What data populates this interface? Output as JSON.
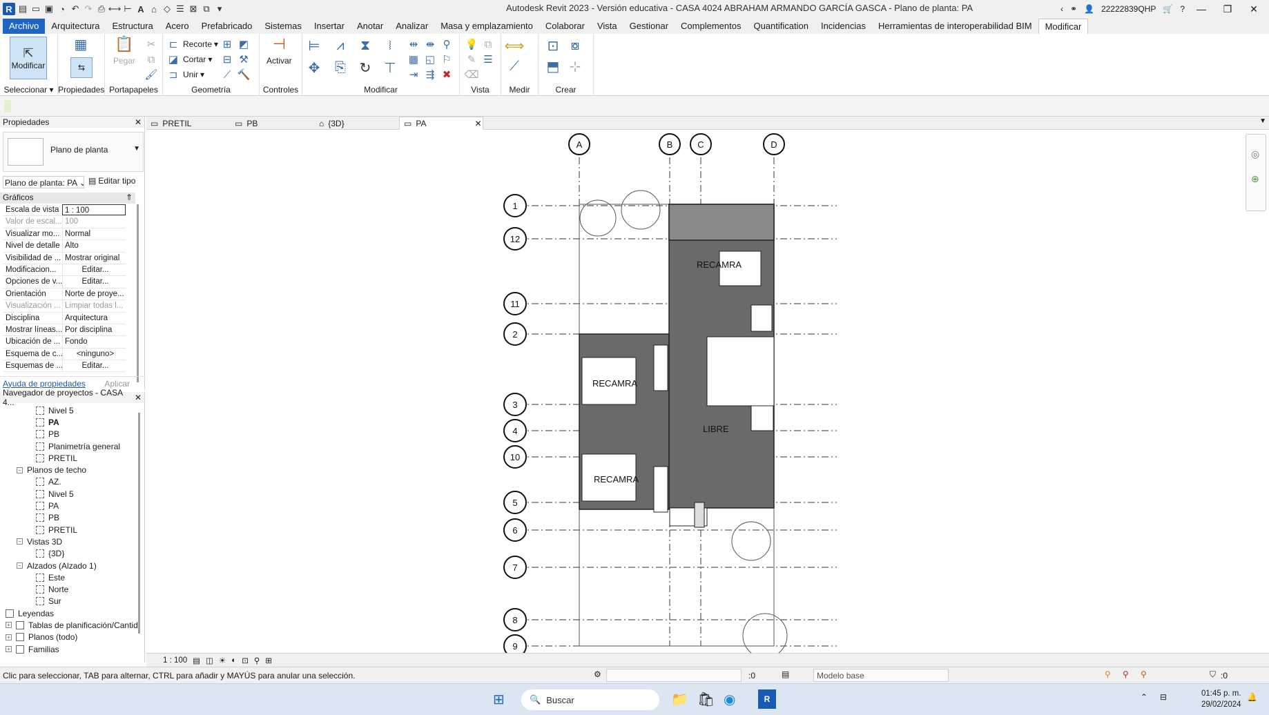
{
  "titlebar": {
    "title": "Autodesk Revit 2023 - Versión educativa - CASA 4024 ABRAHAM ARMANDO GARCÍA GASCA - Plano de planta: PA",
    "user": "22222839QHP"
  },
  "menu": {
    "items": [
      "Archivo",
      "Arquitectura",
      "Estructura",
      "Acero",
      "Prefabricado",
      "Sistemas",
      "Insertar",
      "Anotar",
      "Analizar",
      "Masa y emplazamiento",
      "Colaborar",
      "Vista",
      "Gestionar",
      "Complementos",
      "Quantification",
      "Incidencias",
      "Herramientas de interoperabilidad BIM",
      "Modificar"
    ]
  },
  "ribbon": {
    "modificar": "Modificar",
    "seleccionar": "Seleccionar ▾",
    "propiedades": "Propiedades",
    "pegar": "Pegar",
    "portapapeles": "Portapapeles",
    "recorte": "Recorte",
    "cortar": "Cortar",
    "unir": "Unir",
    "geometria": "Geometría",
    "activar": "Activar",
    "controles": "Controles",
    "modificar_group": "Modificar",
    "vista": "Vista",
    "medir": "Medir",
    "crear": "Crear"
  },
  "properties": {
    "header": "Propiedades",
    "type_name": "Plano de planta",
    "view_selector": "Plano de planta: PA",
    "edit_type": "Editar tipo",
    "section": "Gráficos",
    "rows": [
      {
        "k": "Escala de vista",
        "v": "1 : 100"
      },
      {
        "k": "Valor de escal...",
        "v": "100"
      },
      {
        "k": "Visualizar mo...",
        "v": "Normal"
      },
      {
        "k": "Nivel de detalle",
        "v": "Alto"
      },
      {
        "k": "Visibilidad de ...",
        "v": "Mostrar original"
      },
      {
        "k": "Modificacion...",
        "v": "Editar..."
      },
      {
        "k": "Opciones de v...",
        "v": "Editar..."
      },
      {
        "k": "Orientación",
        "v": "Norte de proye..."
      },
      {
        "k": "Visualización ...",
        "v": "Limpiar todas l..."
      },
      {
        "k": "Disciplina",
        "v": "Arquitectura"
      },
      {
        "k": "Mostrar líneas...",
        "v": "Por disciplina"
      },
      {
        "k": "Ubicación de ...",
        "v": "Fondo"
      },
      {
        "k": "Esquema de c...",
        "v": "<ninguno>"
      },
      {
        "k": "Esquemas de ...",
        "v": "Editar..."
      }
    ],
    "help": "Ayuda de propiedades",
    "apply": "Aplicar"
  },
  "browser": {
    "header": "Navegador de proyectos - CASA 4...",
    "nodes": [
      {
        "label": "Nivel 5",
        "level": 2,
        "kind": "leaf"
      },
      {
        "label": "PA",
        "level": 2,
        "kind": "leaf",
        "bold": true
      },
      {
        "label": "PB",
        "level": 2,
        "kind": "leaf"
      },
      {
        "label": "Planimetría general",
        "level": 2,
        "kind": "leaf"
      },
      {
        "label": "PRETIL",
        "level": 2,
        "kind": "leaf"
      },
      {
        "label": "Planos de techo",
        "level": 1,
        "kind": "group",
        "exp": "−"
      },
      {
        "label": "AZ.",
        "level": 2,
        "kind": "leaf"
      },
      {
        "label": "Nivel 5",
        "level": 2,
        "kind": "leaf"
      },
      {
        "label": "PA",
        "level": 2,
        "kind": "leaf"
      },
      {
        "label": "PB",
        "level": 2,
        "kind": "leaf"
      },
      {
        "label": "PRETIL",
        "level": 2,
        "kind": "leaf"
      },
      {
        "label": "Vistas 3D",
        "level": 1,
        "kind": "group",
        "exp": "−"
      },
      {
        "label": "{3D}",
        "level": 2,
        "kind": "leaf3d"
      },
      {
        "label": "Alzados (Alzado 1)",
        "level": 1,
        "kind": "group",
        "exp": "−"
      },
      {
        "label": "Este",
        "level": 2,
        "kind": "leaf"
      },
      {
        "label": "Norte",
        "level": 2,
        "kind": "leaf"
      },
      {
        "label": "Sur",
        "level": 2,
        "kind": "leaf"
      },
      {
        "label": "Leyendas",
        "level": 0,
        "kind": "root"
      },
      {
        "label": "Tablas de planificación/Cantid",
        "level": 0,
        "kind": "root",
        "exp": "+"
      },
      {
        "label": "Planos (todo)",
        "level": 0,
        "kind": "root",
        "exp": "+"
      },
      {
        "label": "Familias",
        "level": 0,
        "kind": "root",
        "exp": "+"
      }
    ]
  },
  "tabs": [
    {
      "label": "PRETIL",
      "icon": "floor-plan-icon"
    },
    {
      "label": "PB",
      "icon": "floor-plan-icon"
    },
    {
      "label": "{3D}",
      "icon": "cube-icon"
    },
    {
      "label": "PA",
      "icon": "floor-plan-icon",
      "active": true
    }
  ],
  "plan": {
    "grid_letters": [
      "A",
      "B",
      "C",
      "D"
    ],
    "grid_numbers": [
      "1",
      "12",
      "11",
      "2",
      "3",
      "4",
      "10",
      "5",
      "6",
      "7",
      "8",
      "9"
    ],
    "rooms": [
      "RECAMRA",
      "RECAMRA",
      "LIBRE",
      "RECAMRA"
    ]
  },
  "view_control": {
    "scale": "1 : 100"
  },
  "status": {
    "hint": "Clic para seleccionar, TAB para alternar, CTRL para añadir y MAYÚS para anular una selección.",
    "count": ":0",
    "model": "Modelo base",
    "filter": ":0"
  },
  "taskbar": {
    "search": "Buscar",
    "time": "01:45 p. m.",
    "date": "29/02/2024"
  }
}
